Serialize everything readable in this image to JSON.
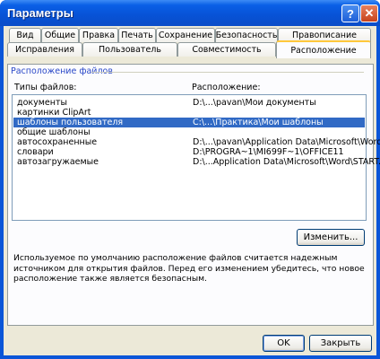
{
  "window": {
    "title": "Параметры",
    "help_glyph": "?",
    "close_glyph": "✕"
  },
  "tabs_row1": [
    "Вид",
    "Общие",
    "Правка",
    "Печать",
    "Сохранение",
    "Безопасность",
    "Правописание"
  ],
  "tabs_row2": [
    "Исправления",
    "Пользователь",
    "Совместимость",
    "Расположение"
  ],
  "active_tab": "Расположение",
  "section": {
    "title": "Расположение файлов",
    "col_types": "Типы файлов:",
    "col_location": "Расположение:"
  },
  "file_locations": [
    {
      "type": "документы",
      "location": "D:\\...\\pavan\\Мои документы",
      "selected": false
    },
    {
      "type": "картинки ClipArt",
      "location": "",
      "selected": false
    },
    {
      "type": "шаблоны пользователя",
      "location": "C:\\...\\Практика\\Мои шаблоны",
      "selected": true
    },
    {
      "type": "общие шаблоны",
      "location": "",
      "selected": false
    },
    {
      "type": "автосохраненные",
      "location": "D:\\...\\pavan\\Application Data\\Microsoft\\Word",
      "selected": false
    },
    {
      "type": "словари",
      "location": "D:\\PROGRA~1\\MI699F~1\\OFFICE11",
      "selected": false
    },
    {
      "type": "автозагружаемые",
      "location": "D:\\...Application Data\\Microsoft\\Word\\START...",
      "selected": false
    }
  ],
  "buttons": {
    "modify": "Изменить...",
    "ok": "OK",
    "close": "Закрыть"
  },
  "description": "Используемое по умолчанию расположение файлов считается надежным источником для открытия файлов. Перед его изменением убедитесь, что новое расположение также является безопасным."
}
